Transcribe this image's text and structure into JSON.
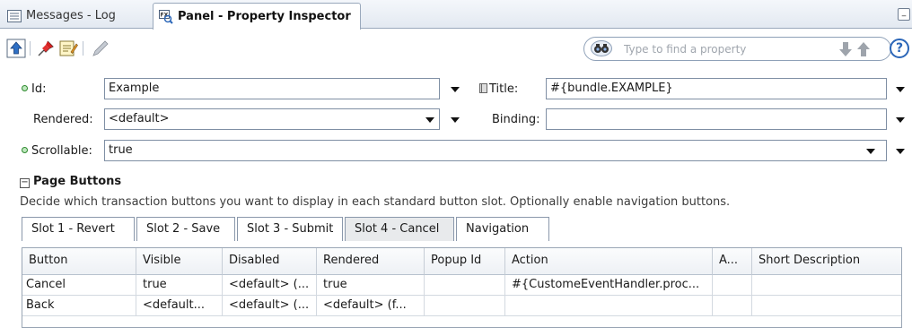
{
  "tabs": {
    "log_label": "Messages - Log",
    "inspector_label": "Panel - Property Inspector"
  },
  "toolbar": {
    "icons": [
      "up-navigate-icon",
      "pin-icon",
      "edit-properties-icon",
      "pencil-icon"
    ],
    "search_placeholder": "Type to find a property"
  },
  "form": {
    "id_label": "Id:",
    "id_value": "Example",
    "title_label": "Title:",
    "title_value": "#{bundle.EXAMPLE}",
    "rendered_label": "Rendered:",
    "rendered_value": "<default>",
    "binding_label": "Binding:",
    "binding_value": "",
    "scrollable_label": "Scrollable:",
    "scrollable_value": "true"
  },
  "section": {
    "title": "Page Buttons",
    "description": "Decide which transaction buttons you want to display in each standard button slot. Optionally enable navigation buttons."
  },
  "slot_tabs": [
    "Slot 1 - Revert",
    "Slot 2 - Save",
    "Slot 3 - Submit",
    "Slot 4 - Cancel",
    "Navigation"
  ],
  "active_slot_tab": "Slot 4 - Cancel",
  "table": {
    "columns": [
      "Button",
      "Visible",
      "Disabled",
      "Rendered",
      "Popup Id",
      "Action",
      "A...",
      "Short Description"
    ],
    "rows": [
      [
        "Cancel",
        "true",
        "<default> (...",
        "true",
        "",
        "#{CustomeEventHandler.proc...",
        "",
        ""
      ],
      [
        "Back",
        "<default...",
        "<default> (...",
        "<default> (f...",
        "",
        "",
        "",
        ""
      ]
    ]
  },
  "colors": {
    "accent": "#2b66b8",
    "tab_border": "#9aa9bc",
    "active_tab_bg": "#e8eaec"
  }
}
